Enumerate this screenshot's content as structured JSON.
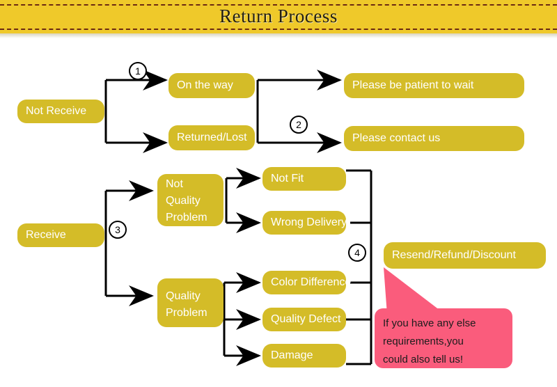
{
  "header": {
    "title": "Return Process",
    "band_color": "#efc92a",
    "dash_color": "#6b2a12"
  },
  "theme": {
    "node_fill": "#d4bc28",
    "node_text": "#ffffff",
    "line_color": "#000000",
    "callout_fill": "#fa5c7c",
    "callout_text": "#1c1c1c"
  },
  "flow": {
    "nodes": [
      {
        "id": "not-receive",
        "label": "Not Receive"
      },
      {
        "id": "on-the-way",
        "label": "On the way"
      },
      {
        "id": "returned-lost",
        "label": "Returned/Lost"
      },
      {
        "id": "please-wait",
        "label": "Please be patient to wait"
      },
      {
        "id": "please-contact",
        "label": "Please contact us"
      },
      {
        "id": "receive",
        "label": "Receive"
      },
      {
        "id": "not-quality",
        "label": "Not Quality Problem"
      },
      {
        "id": "quality-problem",
        "label": "Quality Problem"
      },
      {
        "id": "not-fit",
        "label": "Not Fit"
      },
      {
        "id": "wrong-delivery",
        "label": "Wrong Delivery"
      },
      {
        "id": "color-difference",
        "label": "Color Difference"
      },
      {
        "id": "quality-defect",
        "label": "Quality Defect"
      },
      {
        "id": "damage",
        "label": "Damage"
      },
      {
        "id": "resend-refund",
        "label": "Resend/Refund/Discount"
      }
    ],
    "step_markers": [
      {
        "id": "step-1",
        "label": "1"
      },
      {
        "id": "step-2",
        "label": "2"
      },
      {
        "id": "step-3",
        "label": "3"
      },
      {
        "id": "step-4",
        "label": "4"
      }
    ]
  },
  "callout": {
    "line1": "If you have any else",
    "line2": "requirements,you",
    "line3": "could also tell us!"
  }
}
